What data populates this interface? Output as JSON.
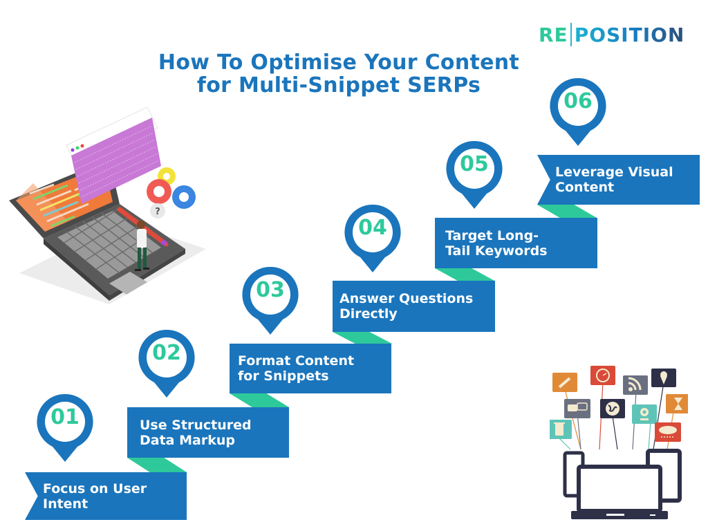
{
  "brand": {
    "logo_left": "RE",
    "logo_right": "POSITION",
    "colors": {
      "primary_blue": "#1a75bc",
      "accent_green": "#2ec99b",
      "white": "#ffffff"
    }
  },
  "header": {
    "title_line1": "How To Optimise Your Content",
    "title_line2": "for Multi-Snippet SERPs"
  },
  "steps": [
    {
      "number": "01",
      "line1": "Focus on User",
      "line2": "Intent"
    },
    {
      "number": "02",
      "line1": "Use Structured",
      "line2": "Data Markup"
    },
    {
      "number": "03",
      "line1": "Format Content",
      "line2": "for Snippets"
    },
    {
      "number": "04",
      "line1": "Answer Questions",
      "line2": "Directly"
    },
    {
      "number": "05",
      "line1": "Target Long-",
      "line2": "Tail Keywords"
    },
    {
      "number": "06",
      "line1": "Leverage Visual",
      "line2": "Content"
    }
  ],
  "illustrations": {
    "left": "laptop-with-code-and-gears-illustration",
    "right": "devices-with-app-icons-illustration"
  }
}
